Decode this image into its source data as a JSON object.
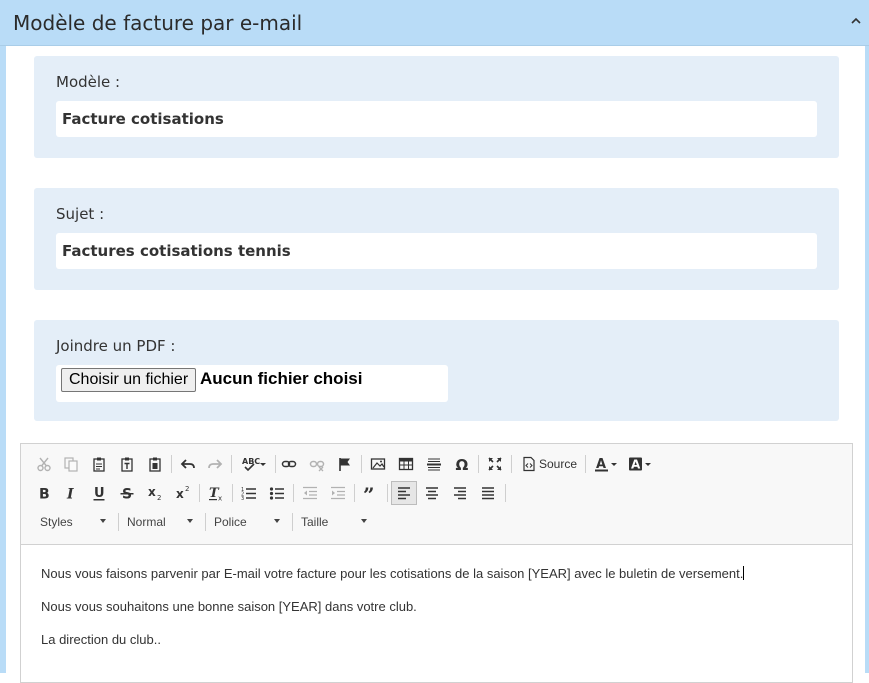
{
  "header": {
    "title": "Modèle de facture par e-mail",
    "collapse_icon": "chevron-up-icon"
  },
  "template_field": {
    "label": "Modèle :",
    "value": "Facture cotisations"
  },
  "subject_field": {
    "label": "Sujet :",
    "value": "Factures cotisations tennis"
  },
  "pdf_field": {
    "label": "Joindre un PDF :",
    "button_label": "Choisir un fichier",
    "status": "Aucun fichier choisi"
  },
  "editor": {
    "toolbar": {
      "source_label": "Source",
      "combos": {
        "styles": "Styles",
        "format": "Normal",
        "font": "Police",
        "size": "Taille"
      },
      "icons": [
        "cut-icon",
        "copy-icon",
        "paste-icon",
        "paste-text-icon",
        "paste-word-icon",
        "undo-icon",
        "redo-icon",
        "spellcheck-icon",
        "link-icon",
        "unlink-icon",
        "anchor-icon",
        "image-icon",
        "table-icon",
        "horizontal-line-icon",
        "special-char-icon",
        "maximize-icon",
        "source-icon",
        "text-color-icon",
        "bg-color-icon",
        "bold-icon",
        "italic-icon",
        "underline-icon",
        "strike-icon",
        "subscript-icon",
        "superscript-icon",
        "remove-format-icon",
        "numbered-list-icon",
        "bulleted-list-icon",
        "outdent-icon",
        "indent-icon",
        "blockquote-icon",
        "align-left-icon",
        "align-center-icon",
        "align-right-icon",
        "justify-icon"
      ]
    },
    "content": [
      "Nous vous faisons parvenir par E-mail votre facture pour les cotisations de la saison [YEAR] avec le buletin de versement.",
      "Nous vous souhaitons une bonne saison [YEAR] dans votre club.",
      "La direction du club.."
    ]
  }
}
